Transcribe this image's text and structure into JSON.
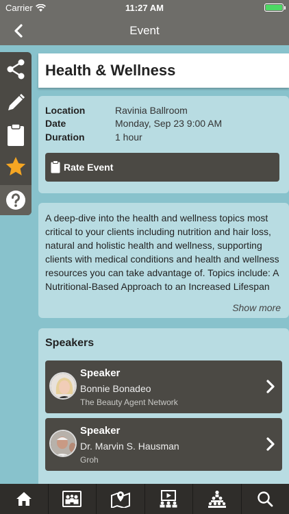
{
  "status_bar": {
    "carrier": "Carrier",
    "time": "11:27 AM"
  },
  "nav": {
    "title": "Event",
    "back_icon": "chevron-left-icon"
  },
  "side_tools": [
    {
      "name": "share-icon"
    },
    {
      "name": "pencil-icon"
    },
    {
      "name": "clipboard-icon"
    },
    {
      "name": "star-icon",
      "color": "#f5a623"
    },
    {
      "name": "help-icon"
    }
  ],
  "event": {
    "title": "Health & Wellness",
    "location_label": "Location",
    "location": "Ravinia Ballroom",
    "date_label": "Date",
    "date": "Monday, Sep 23 9:00 AM",
    "duration_label": "Duration",
    "duration": "1 hour",
    "rate_label": "Rate Event"
  },
  "description": {
    "text": "A deep-dive into the health and wellness topics most critical to your clients including nutrition and hair loss, natural and holistic health and wellness, supporting clients with medical conditions and health and wellness resources you can take advantage of. Topics include: A Nutritional-Based Approach to an Increased Lifespan with Marvin S. Hausman, M.D.",
    "show_more": "Show more"
  },
  "speakers": {
    "heading": "Speakers",
    "items": [
      {
        "role": "Speaker",
        "name": "Bonnie Bonadeo",
        "org": "The Beauty Agent Network"
      },
      {
        "role": "Speaker",
        "name": "Dr. Marvin S. Hausman",
        "org": "Groh"
      }
    ]
  },
  "tabs": [
    {
      "name": "tab-home-icon"
    },
    {
      "name": "tab-exhibitors-icon"
    },
    {
      "name": "tab-map-icon"
    },
    {
      "name": "tab-media-icon"
    },
    {
      "name": "tab-attendees-icon"
    },
    {
      "name": "tab-search-icon"
    }
  ],
  "colors": {
    "bar": "#6e6d69",
    "dark": "#4b4944",
    "background": "#88c2cc",
    "card": "#b8dce2"
  }
}
